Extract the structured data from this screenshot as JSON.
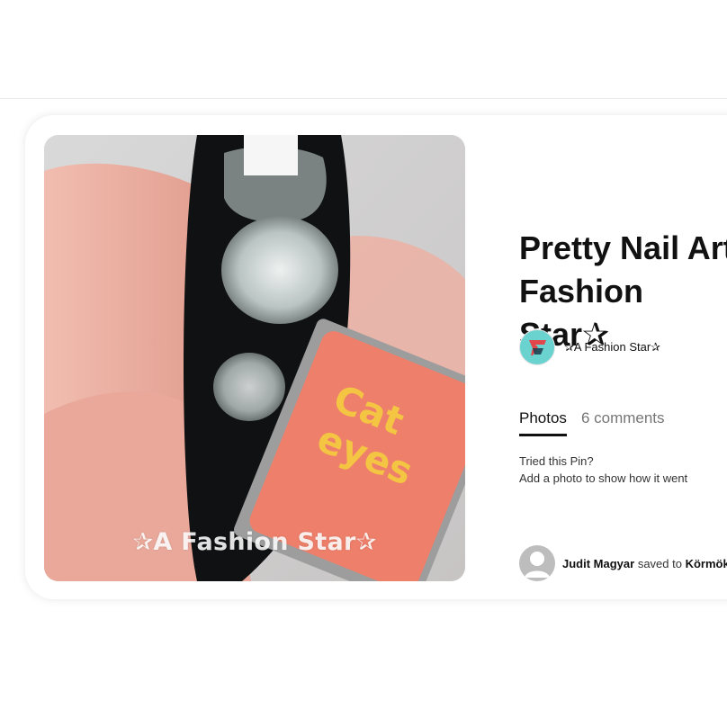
{
  "pin": {
    "title": "Pretty Nail Art\nFashion Star✰",
    "image_alt": "Cat eyes magnetic nail polish demo",
    "watermark": "✰A Fashion Star✰",
    "product_label_line1": "Cat",
    "product_label_line2": "eyes"
  },
  "creator": {
    "name": "✰A Fashion Star✰",
    "avatar_icon": "fashion-star-logo"
  },
  "tabs": [
    {
      "label": "Photos",
      "active": true
    },
    {
      "label": "6 comments",
      "active": false
    }
  ],
  "tried": {
    "question": "Tried this Pin?",
    "prompt": "Add a photo to show how it went"
  },
  "saved_by": {
    "user": "Judit Magyar",
    "action": "saved to",
    "board": "Körmök"
  },
  "colors": {
    "accent": "#111111",
    "card_shadow": "#e6e6e6",
    "creator_avatar_bg": "#6ad2cf",
    "creator_logo": "#e2454a"
  }
}
